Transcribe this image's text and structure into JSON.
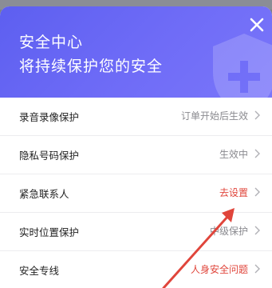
{
  "header": {
    "line1": "安全中心",
    "line2": "将持续保护您的安全",
    "close_icon": "close-icon",
    "background_color": "#6563f4"
  },
  "rows": [
    {
      "label": "录音录像保护",
      "status": "订单开始后生效",
      "status_color": "#8a8a8f"
    },
    {
      "label": "隐私号码保护",
      "status": "生效中",
      "status_color": "#8a8a8f"
    },
    {
      "label": "紧急联系人",
      "status": "去设置",
      "status_color": "#e0453b"
    },
    {
      "label": "实时位置保护",
      "status": "中级保护",
      "status_color": "#8a8a8f"
    },
    {
      "label": "安全专线",
      "status": "人身安全问题",
      "status_color": "#e0453b"
    }
  ],
  "annotation": {
    "icon": "red-arrow-icon",
    "color": "#e0453b"
  }
}
